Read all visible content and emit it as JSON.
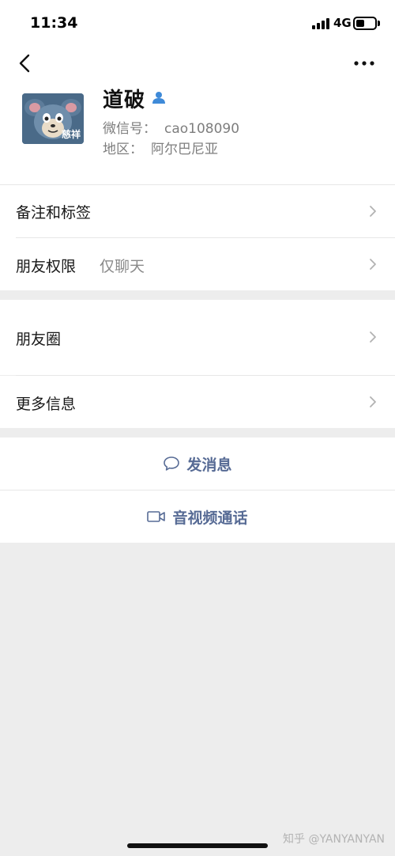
{
  "status_bar": {
    "time": "11:34",
    "network": "4G"
  },
  "profile": {
    "name": "道破",
    "wechat_id_label": "微信号：",
    "wechat_id": "cao108090",
    "region_label": "地区：",
    "region": "阿尔巴尼亚",
    "avatar_badge": "慈祥"
  },
  "rows": {
    "remark": "备注和标签",
    "permissions": "朋友权限",
    "permissions_value": "仅聊天",
    "moments": "朋友圈",
    "more_info": "更多信息"
  },
  "actions": {
    "message": "发消息",
    "call": "音视频通话"
  },
  "watermark": "知乎 @YANYANYAN",
  "colors": {
    "link": "#576b95",
    "background": "#ededed",
    "accent_icon": "#3f8ad8"
  }
}
